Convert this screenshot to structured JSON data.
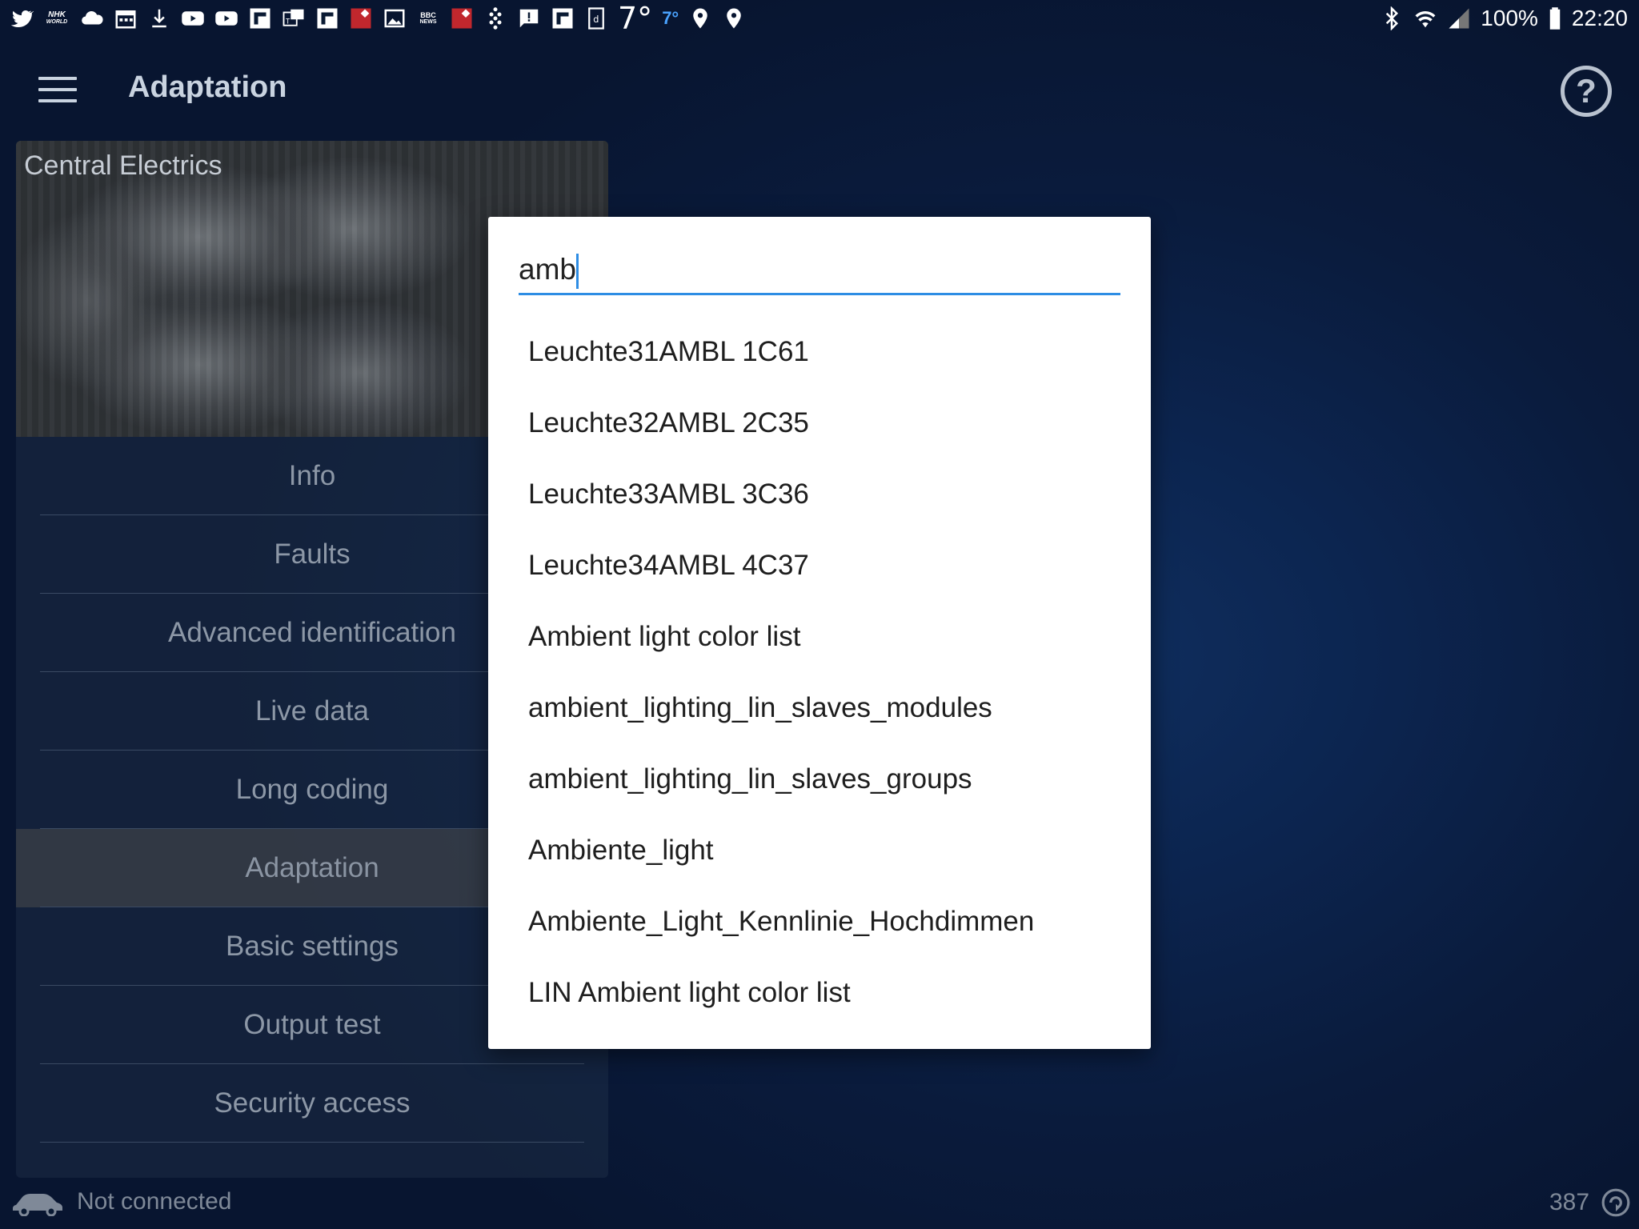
{
  "status_bar": {
    "temp_large": "7°",
    "temp_small": "7°",
    "nhk_line1": "NHK",
    "nhk_line2": "WORLD",
    "bbc_line1": "BBC",
    "bbc_line2": "NEWS",
    "battery": "100%",
    "time": "22:20"
  },
  "app_bar": {
    "title": "Adaptation",
    "help_label": "?"
  },
  "panel": {
    "title": "Central Electrics",
    "items": [
      {
        "label": "Info"
      },
      {
        "label": "Faults"
      },
      {
        "label": "Advanced identification"
      },
      {
        "label": "Live data"
      },
      {
        "label": "Long coding"
      },
      {
        "label": "Adaptation",
        "active": true
      },
      {
        "label": "Basic settings"
      },
      {
        "label": "Output test"
      },
      {
        "label": "Security access"
      }
    ]
  },
  "footer": {
    "connection": "Not connected",
    "count": "387"
  },
  "dialog": {
    "search_value": "amb",
    "results": [
      "Leuchte31AMBL 1C61",
      "Leuchte32AMBL 2C35",
      "Leuchte33AMBL 3C36",
      "Leuchte34AMBL 4C37",
      "Ambient light color list",
      "ambient_lighting_lin_slaves_modules",
      "ambient_lighting_lin_slaves_groups",
      "Ambiente_light",
      "Ambiente_Light_Kennlinie_Hochdimmen",
      "LIN Ambient light color list"
    ]
  },
  "colors": {
    "accent": "#2e8de4",
    "background": "#0c2550",
    "menu_text": "#8c97a6"
  }
}
